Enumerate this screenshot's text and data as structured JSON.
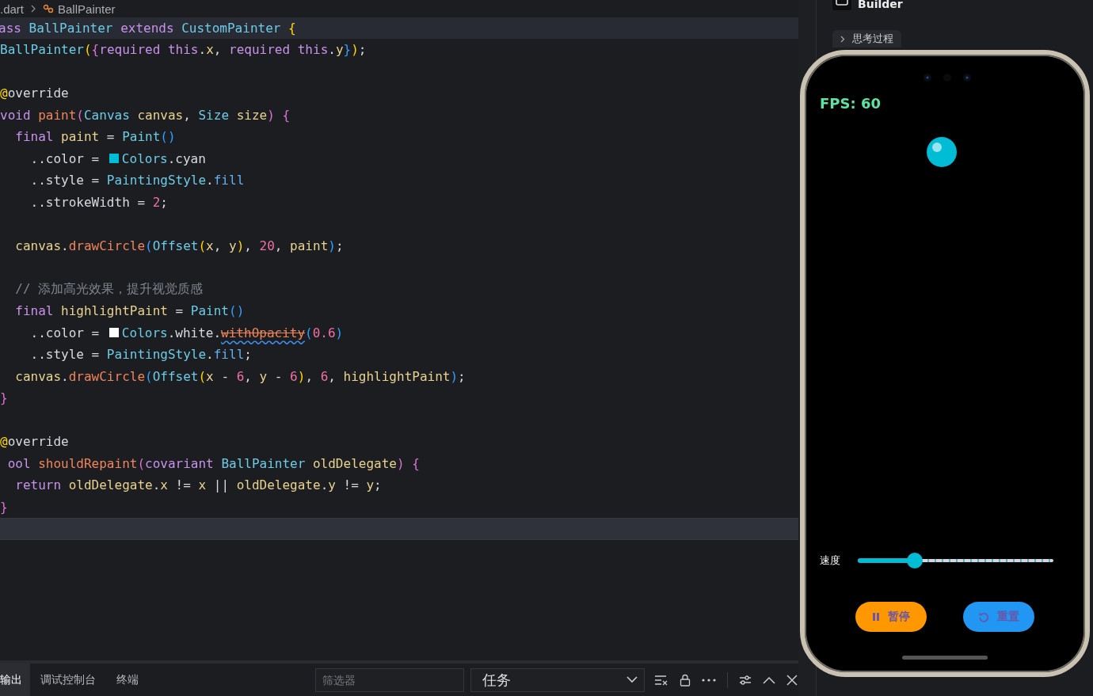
{
  "breadcrumb": {
    "file": ".dart",
    "symbol": "BallPainter"
  },
  "sticky_line": {
    "tokens": [
      {
        "text": "ass ",
        "kind": "kw"
      },
      {
        "text": "BallPainter ",
        "kind": "type"
      },
      {
        "text": "extends ",
        "kind": "kw"
      },
      {
        "text": "CustomPainter ",
        "kind": "type"
      },
      {
        "text": "{",
        "kind": "b1"
      }
    ]
  },
  "code_lines": [
    {
      "current": false,
      "tokens": [
        {
          "text": "BallPainter",
          "kind": "type"
        },
        {
          "text": "(",
          "kind": "b1"
        },
        {
          "text": "{",
          "kind": "b2"
        },
        {
          "text": "required this",
          "kind": "kw"
        },
        {
          "text": ".",
          "kind": "plain"
        },
        {
          "text": "x",
          "kind": "var"
        },
        {
          "text": ", ",
          "kind": "plain"
        },
        {
          "text": "required this",
          "kind": "kw"
        },
        {
          "text": ".",
          "kind": "plain"
        },
        {
          "text": "y",
          "kind": "var"
        },
        {
          "text": "}",
          "kind": "b3"
        },
        {
          "text": ")",
          "kind": "b1"
        },
        {
          "text": ";",
          "kind": "plain"
        }
      ]
    },
    {
      "current": false
    },
    {
      "current": false,
      "tokens": [
        {
          "text": "@",
          "kind": "b1"
        },
        {
          "text": "override",
          "kind": "plain"
        }
      ]
    },
    {
      "current": false,
      "tokens": [
        {
          "text": "void ",
          "kind": "kw"
        },
        {
          "text": "paint",
          "kind": "fn"
        },
        {
          "text": "(",
          "kind": "b2"
        },
        {
          "text": "Canvas ",
          "kind": "type"
        },
        {
          "text": "canvas",
          "kind": "var"
        },
        {
          "text": ", ",
          "kind": "plain"
        },
        {
          "text": "Size ",
          "kind": "type"
        },
        {
          "text": "size",
          "kind": "var"
        },
        {
          "text": ") ",
          "kind": "b2"
        },
        {
          "text": "{",
          "kind": "b2"
        }
      ]
    },
    {
      "current": false,
      "tokens": [
        {
          "text": "  final ",
          "kind": "kw"
        },
        {
          "text": "paint",
          "kind": "var"
        },
        {
          "text": " = ",
          "kind": "plain"
        },
        {
          "text": "Paint",
          "kind": "type"
        },
        {
          "text": "()",
          "kind": "b3"
        }
      ]
    },
    {
      "current": false,
      "tokens": [
        {
          "text": "    ..color = ",
          "kind": "plain"
        },
        {
          "kind": "swatch",
          "color": "#00bcd4"
        },
        {
          "text": "Colors",
          "kind": "type"
        },
        {
          "text": ".cyan",
          "kind": "plain"
        }
      ]
    },
    {
      "current": false,
      "tokens": [
        {
          "text": "    ..style = ",
          "kind": "plain"
        },
        {
          "text": "PaintingStyle",
          "kind": "type"
        },
        {
          "text": ".",
          "kind": "plain"
        },
        {
          "text": "fill",
          "kind": "prop"
        }
      ]
    },
    {
      "current": false,
      "tokens": [
        {
          "text": "    ..strokeWidth = ",
          "kind": "plain"
        },
        {
          "text": "2",
          "kind": "num"
        },
        {
          "text": ";",
          "kind": "plain"
        }
      ]
    },
    {
      "current": false
    },
    {
      "current": false,
      "tokens": [
        {
          "text": "  canvas",
          "kind": "var"
        },
        {
          "text": ".",
          "kind": "plain"
        },
        {
          "text": "drawCircle",
          "kind": "fn"
        },
        {
          "text": "(",
          "kind": "b3"
        },
        {
          "text": "Offset",
          "kind": "type"
        },
        {
          "text": "(",
          "kind": "b1"
        },
        {
          "text": "x",
          "kind": "var"
        },
        {
          "text": ", ",
          "kind": "plain"
        },
        {
          "text": "y",
          "kind": "var"
        },
        {
          "text": ")",
          "kind": "b1"
        },
        {
          "text": ", ",
          "kind": "plain"
        },
        {
          "text": "20",
          "kind": "num"
        },
        {
          "text": ", ",
          "kind": "plain"
        },
        {
          "text": "paint",
          "kind": "var"
        },
        {
          "text": ")",
          "kind": "b3"
        },
        {
          "text": ";",
          "kind": "plain"
        }
      ]
    },
    {
      "current": false
    },
    {
      "current": false,
      "tokens": [
        {
          "text": "  // 添加高光效果，提升视觉质感",
          "kind": "comment"
        }
      ]
    },
    {
      "current": false,
      "tokens": [
        {
          "text": "  final ",
          "kind": "kw"
        },
        {
          "text": "highlightPaint",
          "kind": "var"
        },
        {
          "text": " = ",
          "kind": "plain"
        },
        {
          "text": "Paint",
          "kind": "type"
        },
        {
          "text": "()",
          "kind": "b3"
        }
      ]
    },
    {
      "current": false,
      "tokens": [
        {
          "text": "    ..color = ",
          "kind": "plain"
        },
        {
          "kind": "swatch",
          "color": "#ffffff"
        },
        {
          "text": "Colors",
          "kind": "type"
        },
        {
          "text": ".white.",
          "kind": "plain"
        },
        {
          "text": "withOpacity",
          "kind": "deprecated"
        },
        {
          "text": "(",
          "kind": "b3"
        },
        {
          "text": "0.6",
          "kind": "num"
        },
        {
          "text": ")",
          "kind": "b3"
        }
      ]
    },
    {
      "current": false,
      "tokens": [
        {
          "text": "    ..style = ",
          "kind": "plain"
        },
        {
          "text": "PaintingStyle",
          "kind": "type"
        },
        {
          "text": ".",
          "kind": "plain"
        },
        {
          "text": "fill",
          "kind": "prop"
        },
        {
          "text": ";",
          "kind": "plain"
        }
      ]
    },
    {
      "current": false,
      "tokens": [
        {
          "text": "  canvas",
          "kind": "var"
        },
        {
          "text": ".",
          "kind": "plain"
        },
        {
          "text": "drawCircle",
          "kind": "fn"
        },
        {
          "text": "(",
          "kind": "b3"
        },
        {
          "text": "Offset",
          "kind": "type"
        },
        {
          "text": "(",
          "kind": "b1"
        },
        {
          "text": "x",
          "kind": "var"
        },
        {
          "text": " - ",
          "kind": "plain"
        },
        {
          "text": "6",
          "kind": "num"
        },
        {
          "text": ", ",
          "kind": "plain"
        },
        {
          "text": "y",
          "kind": "var"
        },
        {
          "text": " - ",
          "kind": "plain"
        },
        {
          "text": "6",
          "kind": "num"
        },
        {
          "text": ")",
          "kind": "b1"
        },
        {
          "text": ", ",
          "kind": "plain"
        },
        {
          "text": "6",
          "kind": "num"
        },
        {
          "text": ", ",
          "kind": "plain"
        },
        {
          "text": "highlightPaint",
          "kind": "var"
        },
        {
          "text": ")",
          "kind": "b3"
        },
        {
          "text": ";",
          "kind": "plain"
        }
      ]
    },
    {
      "current": false,
      "tokens": [
        {
          "text": "}",
          "kind": "b2"
        }
      ]
    },
    {
      "current": false
    },
    {
      "current": false,
      "tokens": [
        {
          "text": "@",
          "kind": "b1"
        },
        {
          "text": "override",
          "kind": "plain"
        }
      ]
    },
    {
      "current": false,
      "tokens": [
        {
          "text": " ool ",
          "kind": "kw"
        },
        {
          "text": "shouldRepaint",
          "kind": "fn"
        },
        {
          "text": "(",
          "kind": "b2"
        },
        {
          "text": "covariant ",
          "kind": "kw"
        },
        {
          "text": "BallPainter ",
          "kind": "type"
        },
        {
          "text": "oldDelegate",
          "kind": "var"
        },
        {
          "text": ") ",
          "kind": "b2"
        },
        {
          "text": "{",
          "kind": "b2"
        }
      ]
    },
    {
      "current": false,
      "tokens": [
        {
          "text": "  return ",
          "kind": "kw"
        },
        {
          "text": "oldDelegate",
          "kind": "var"
        },
        {
          "text": ".",
          "kind": "plain"
        },
        {
          "text": "x",
          "kind": "var"
        },
        {
          "text": " != ",
          "kind": "plain"
        },
        {
          "text": "x",
          "kind": "var"
        },
        {
          "text": " || ",
          "kind": "plain"
        },
        {
          "text": "oldDelegate",
          "kind": "var"
        },
        {
          "text": ".",
          "kind": "plain"
        },
        {
          "text": "y",
          "kind": "var"
        },
        {
          "text": " != ",
          "kind": "plain"
        },
        {
          "text": "y",
          "kind": "var"
        },
        {
          "text": ";",
          "kind": "plain"
        }
      ]
    },
    {
      "current": false,
      "tokens": [
        {
          "text": "}",
          "kind": "b2"
        }
      ]
    },
    {
      "current": true
    }
  ],
  "bottom_panel": {
    "tabs": [
      {
        "label": "输出",
        "selected": true
      },
      {
        "label": "调试控制台",
        "selected": false
      },
      {
        "label": "终端",
        "selected": false
      }
    ],
    "filter": {
      "placeholder": "筛选器"
    },
    "task_dropdown": {
      "value": "任务"
    }
  },
  "side_panel": {
    "title": "Builder",
    "thinking_toggle": {
      "label": "思考过程",
      "expanded": false
    }
  },
  "phone_app": {
    "fps": "FPS: 60",
    "speed_slider": {
      "label": "速度",
      "level": 0.29
    },
    "buttons": [
      {
        "label": "暂停",
        "kind": "pause"
      },
      {
        "label": "重置",
        "kind": "reset"
      }
    ]
  }
}
